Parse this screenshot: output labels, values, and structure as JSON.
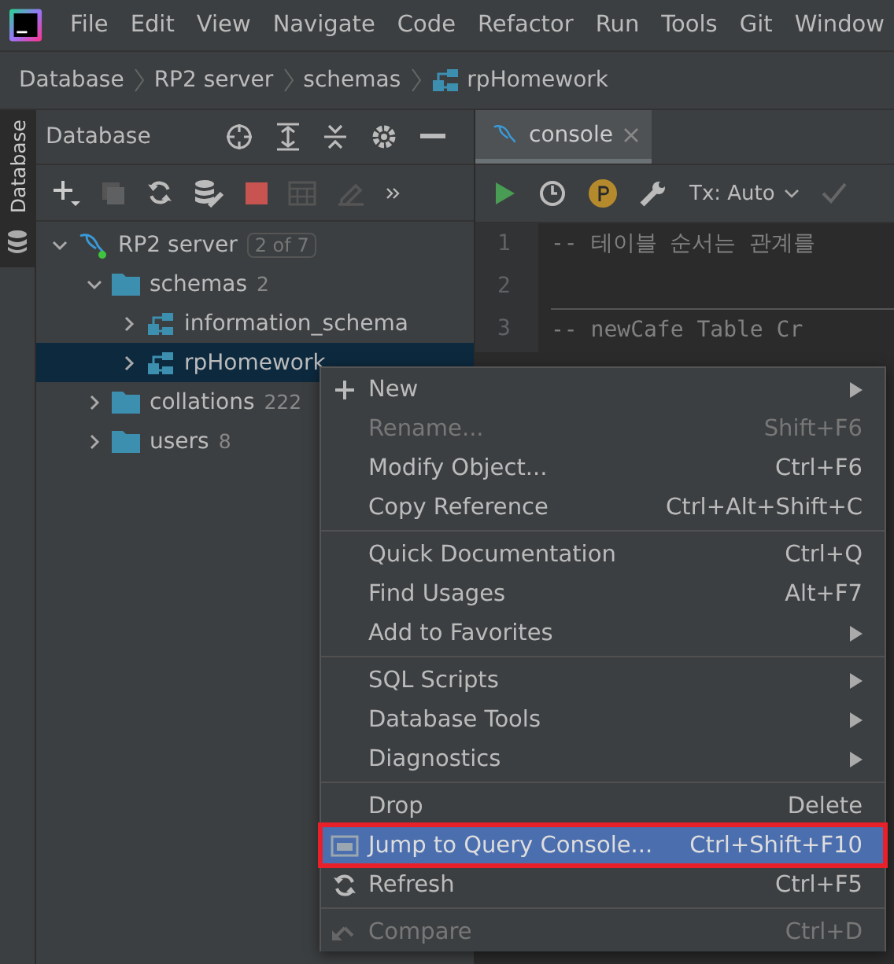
{
  "menu_bar": [
    "File",
    "Edit",
    "View",
    "Navigate",
    "Code",
    "Refactor",
    "Run",
    "Tools",
    "Git",
    "Window"
  ],
  "breadcrumb": [
    {
      "label": "Database",
      "kind": "plain"
    },
    {
      "label": "RP2 server",
      "kind": "plain"
    },
    {
      "label": "schemas",
      "kind": "plain"
    },
    {
      "label": "rpHomework",
      "kind": "schema"
    }
  ],
  "side_strip": {
    "label": "Database"
  },
  "database_panel": {
    "title": "Database",
    "tree": [
      {
        "label": "RP2 server",
        "kind": "server",
        "badge": "2 of 7",
        "expanded": true,
        "selected": false,
        "children": [
          {
            "label": "schemas",
            "kind": "folder",
            "count": "2",
            "expanded": true,
            "selected": false,
            "children": [
              {
                "label": "information_schema",
                "kind": "schema",
                "expanded": false,
                "selected": false
              },
              {
                "label": "rpHomework",
                "kind": "schema",
                "expanded": false,
                "selected": true
              }
            ]
          },
          {
            "label": "collations",
            "kind": "folder",
            "count": "222",
            "expanded": false,
            "selected": false
          },
          {
            "label": "users",
            "kind": "folder",
            "count": "8",
            "expanded": false,
            "selected": false
          }
        ]
      }
    ]
  },
  "editor": {
    "tab": {
      "label": "console",
      "selected": true
    },
    "tx_mode": "Tx: Auto",
    "lines": [
      {
        "number": "1",
        "text": "-- 테이블 순서는 관계를",
        "kind": "comment"
      },
      {
        "number": "2",
        "kind": "blank"
      },
      {
        "number": "3",
        "text": "-- newCafe Table Cr",
        "kind": "comment"
      }
    ]
  },
  "context_menu": [
    {
      "kind": "add",
      "label": "New",
      "submenu": true,
      "disabled": false,
      "selected": false
    },
    {
      "kind": "plain",
      "label": "Rename...",
      "shortcut": "Shift+F6",
      "submenu": false,
      "disabled": true,
      "selected": false
    },
    {
      "kind": "plain",
      "label": "Modify Object...",
      "shortcut": "Ctrl+F6",
      "submenu": false,
      "disabled": false,
      "selected": false
    },
    {
      "kind": "plain",
      "label": "Copy Reference",
      "shortcut": "Ctrl+Alt+Shift+C",
      "submenu": false,
      "disabled": false,
      "selected": false
    },
    {
      "kind": "separator"
    },
    {
      "kind": "plain",
      "label": "Quick Documentation",
      "shortcut": "Ctrl+Q",
      "submenu": false,
      "disabled": false,
      "selected": false
    },
    {
      "kind": "plain",
      "label": "Find Usages",
      "shortcut": "Alt+F7",
      "submenu": false,
      "disabled": false,
      "selected": false
    },
    {
      "kind": "plain",
      "label": "Add to Favorites",
      "submenu": true,
      "disabled": false,
      "selected": false
    },
    {
      "kind": "separator"
    },
    {
      "kind": "plain",
      "label": "SQL Scripts",
      "submenu": true,
      "disabled": false,
      "selected": false
    },
    {
      "kind": "plain",
      "label": "Database Tools",
      "submenu": true,
      "disabled": false,
      "selected": false
    },
    {
      "kind": "plain",
      "label": "Diagnostics",
      "submenu": true,
      "disabled": false,
      "selected": false
    },
    {
      "kind": "separator"
    },
    {
      "kind": "plain",
      "label": "Drop",
      "shortcut": "Delete",
      "submenu": false,
      "disabled": false,
      "selected": false
    },
    {
      "kind": "console",
      "label": "Jump to Query Console...",
      "shortcut": "Ctrl+Shift+F10",
      "submenu": false,
      "disabled": false,
      "selected": true
    },
    {
      "kind": "refresh",
      "label": "Refresh",
      "shortcut": "Ctrl+F5",
      "submenu": false,
      "disabled": false,
      "selected": false
    },
    {
      "kind": "separator"
    },
    {
      "kind": "compare",
      "label": "Compare",
      "shortcut": "Ctrl+D",
      "submenu": false,
      "disabled": true,
      "selected": false
    }
  ]
}
